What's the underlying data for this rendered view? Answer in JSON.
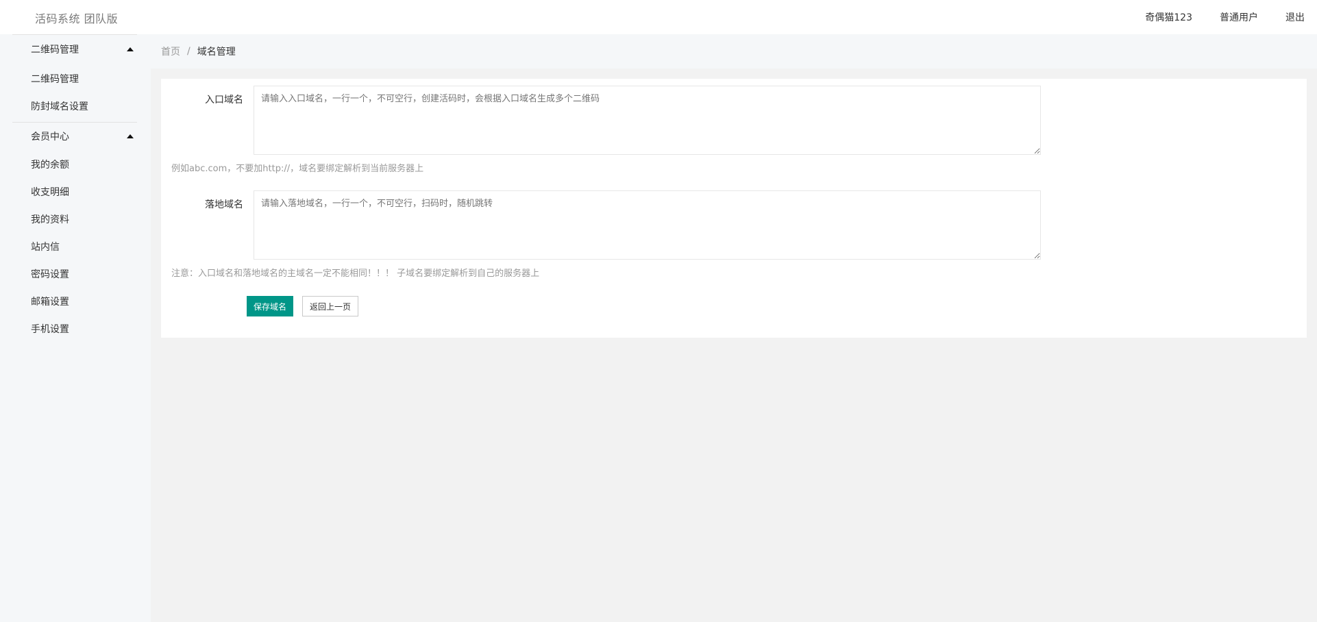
{
  "header": {
    "logo": "活码系统 团队版",
    "username": "奇偶猫123",
    "role": "普通用户",
    "logout": "退出"
  },
  "sidebar": {
    "groups": [
      {
        "title": "二维码管理",
        "items": [
          "二维码管理",
          "防封域名设置"
        ]
      },
      {
        "title": "会员中心",
        "items": [
          "我的余额",
          "收支明细",
          "我的资料",
          "站内信",
          "密码设置",
          "邮箱设置",
          "手机设置"
        ]
      }
    ]
  },
  "breadcrumb": {
    "home": "首页",
    "separator": "/",
    "current": "域名管理"
  },
  "form": {
    "entry_label": "入口域名",
    "entry_placeholder": "请输入入口域名，一行一个，不可空行，创建活码时，会根据入口域名生成多个二维码",
    "entry_value": "",
    "entry_hint": "例如abc.com，不要加http://，域名要绑定解析到当前服务器上",
    "landing_label": "落地域名",
    "landing_placeholder": "请输入落地域名，一行一个，不可空行，扫码时，随机跳转",
    "landing_value": "",
    "landing_hint": "注意：入口域名和落地域名的主域名一定不能相同！！！ 子域名要绑定解析到自己的服务器上",
    "save_button": "保存域名",
    "back_button": "返回上一页"
  },
  "colors": {
    "primary": "#009688",
    "sidebar_bg": "#f5f7f9",
    "page_bg": "#f2f2f2"
  }
}
